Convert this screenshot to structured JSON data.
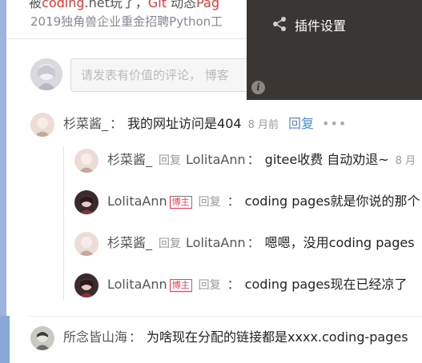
{
  "article": {
    "line1_prefix": "被",
    "line1_red1": "coding",
    "line1_mid": ".net玩了，",
    "line1_red2": "Git",
    "line1_mid2": " 动态",
    "line1_red3": "Pag",
    "line2": "2019独角兽企业重金招聘Python工"
  },
  "comment_input": {
    "placeholder": "请发表有价值的评论， 博客"
  },
  "plugin": {
    "title": "插件设置",
    "share_icon": "share-icon",
    "info_glyph": "i"
  },
  "comments": [
    {
      "user": "杉菜酱_",
      "separator": "：",
      "text": "我的网址访问是404",
      "time": "8 月前",
      "reply_label": "回复",
      "more": "•••"
    }
  ],
  "replies": [
    {
      "user": "杉菜酱_",
      "badge": "",
      "reply_word": "回复",
      "target": "LolitaAnn",
      "separator": "：",
      "text": "gitee收费 自动劝退~",
      "time": "8 月"
    },
    {
      "user": "LolitaAnn",
      "badge": "博主",
      "reply_word": "回复",
      "target": "",
      "separator": "：",
      "text": "coding pages就是你说的那个"
    },
    {
      "user": "杉菜酱_",
      "badge": "",
      "reply_word": "回复",
      "target": "LolitaAnn",
      "separator": "：",
      "text": "嗯嗯，没用coding pages"
    },
    {
      "user": "LolitaAnn",
      "badge": "博主",
      "reply_word": "回复",
      "target": "",
      "separator": "：",
      "text": "coding pages现在已经凉了"
    }
  ],
  "bottom_comment": {
    "user": "所念皆山海",
    "separator": "：",
    "text": "为啥现在分配的链接都是xxxx.coding-pages"
  },
  "colors": {
    "accent_link": "#5b8bd6",
    "badge_red": "#ee4455",
    "panel_bg": "#3a3633"
  }
}
